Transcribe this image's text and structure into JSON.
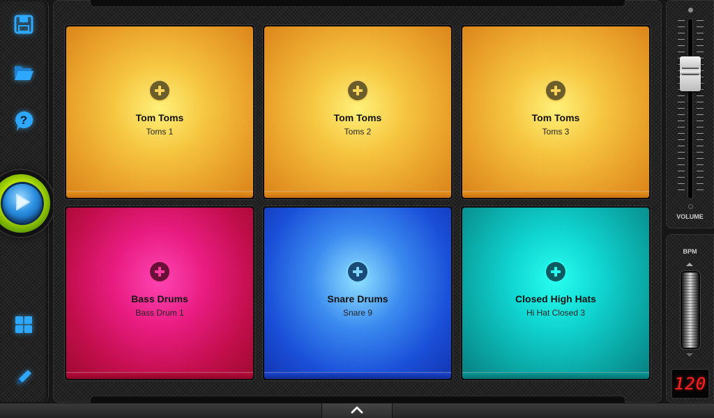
{
  "sidebar": {
    "icons": [
      "save-icon",
      "open-folder-icon",
      "help-icon",
      "play-icon",
      "pad-grid-icon",
      "edit-pencil-icon"
    ],
    "accent": "#2ea8ff"
  },
  "pads": [
    {
      "name": "Tom Toms",
      "sample": "Toms 1",
      "color": "orange"
    },
    {
      "name": "Tom Toms",
      "sample": "Toms 2",
      "color": "orange"
    },
    {
      "name": "Tom Toms",
      "sample": "Toms 3",
      "color": "orange"
    },
    {
      "name": "Bass Drums",
      "sample": "Bass Drum 1",
      "color": "pink"
    },
    {
      "name": "Snare Drums",
      "sample": "Snare 9",
      "color": "blue"
    },
    {
      "name": "Closed High Hats",
      "sample": "Hi Hat Closed 3",
      "color": "teal"
    }
  ],
  "volume": {
    "label": "VOLUME",
    "level": 0.72
  },
  "bpm": {
    "label": "BPM",
    "value": "120"
  },
  "bottom_bar": {
    "icon": "chevron-up-icon"
  }
}
